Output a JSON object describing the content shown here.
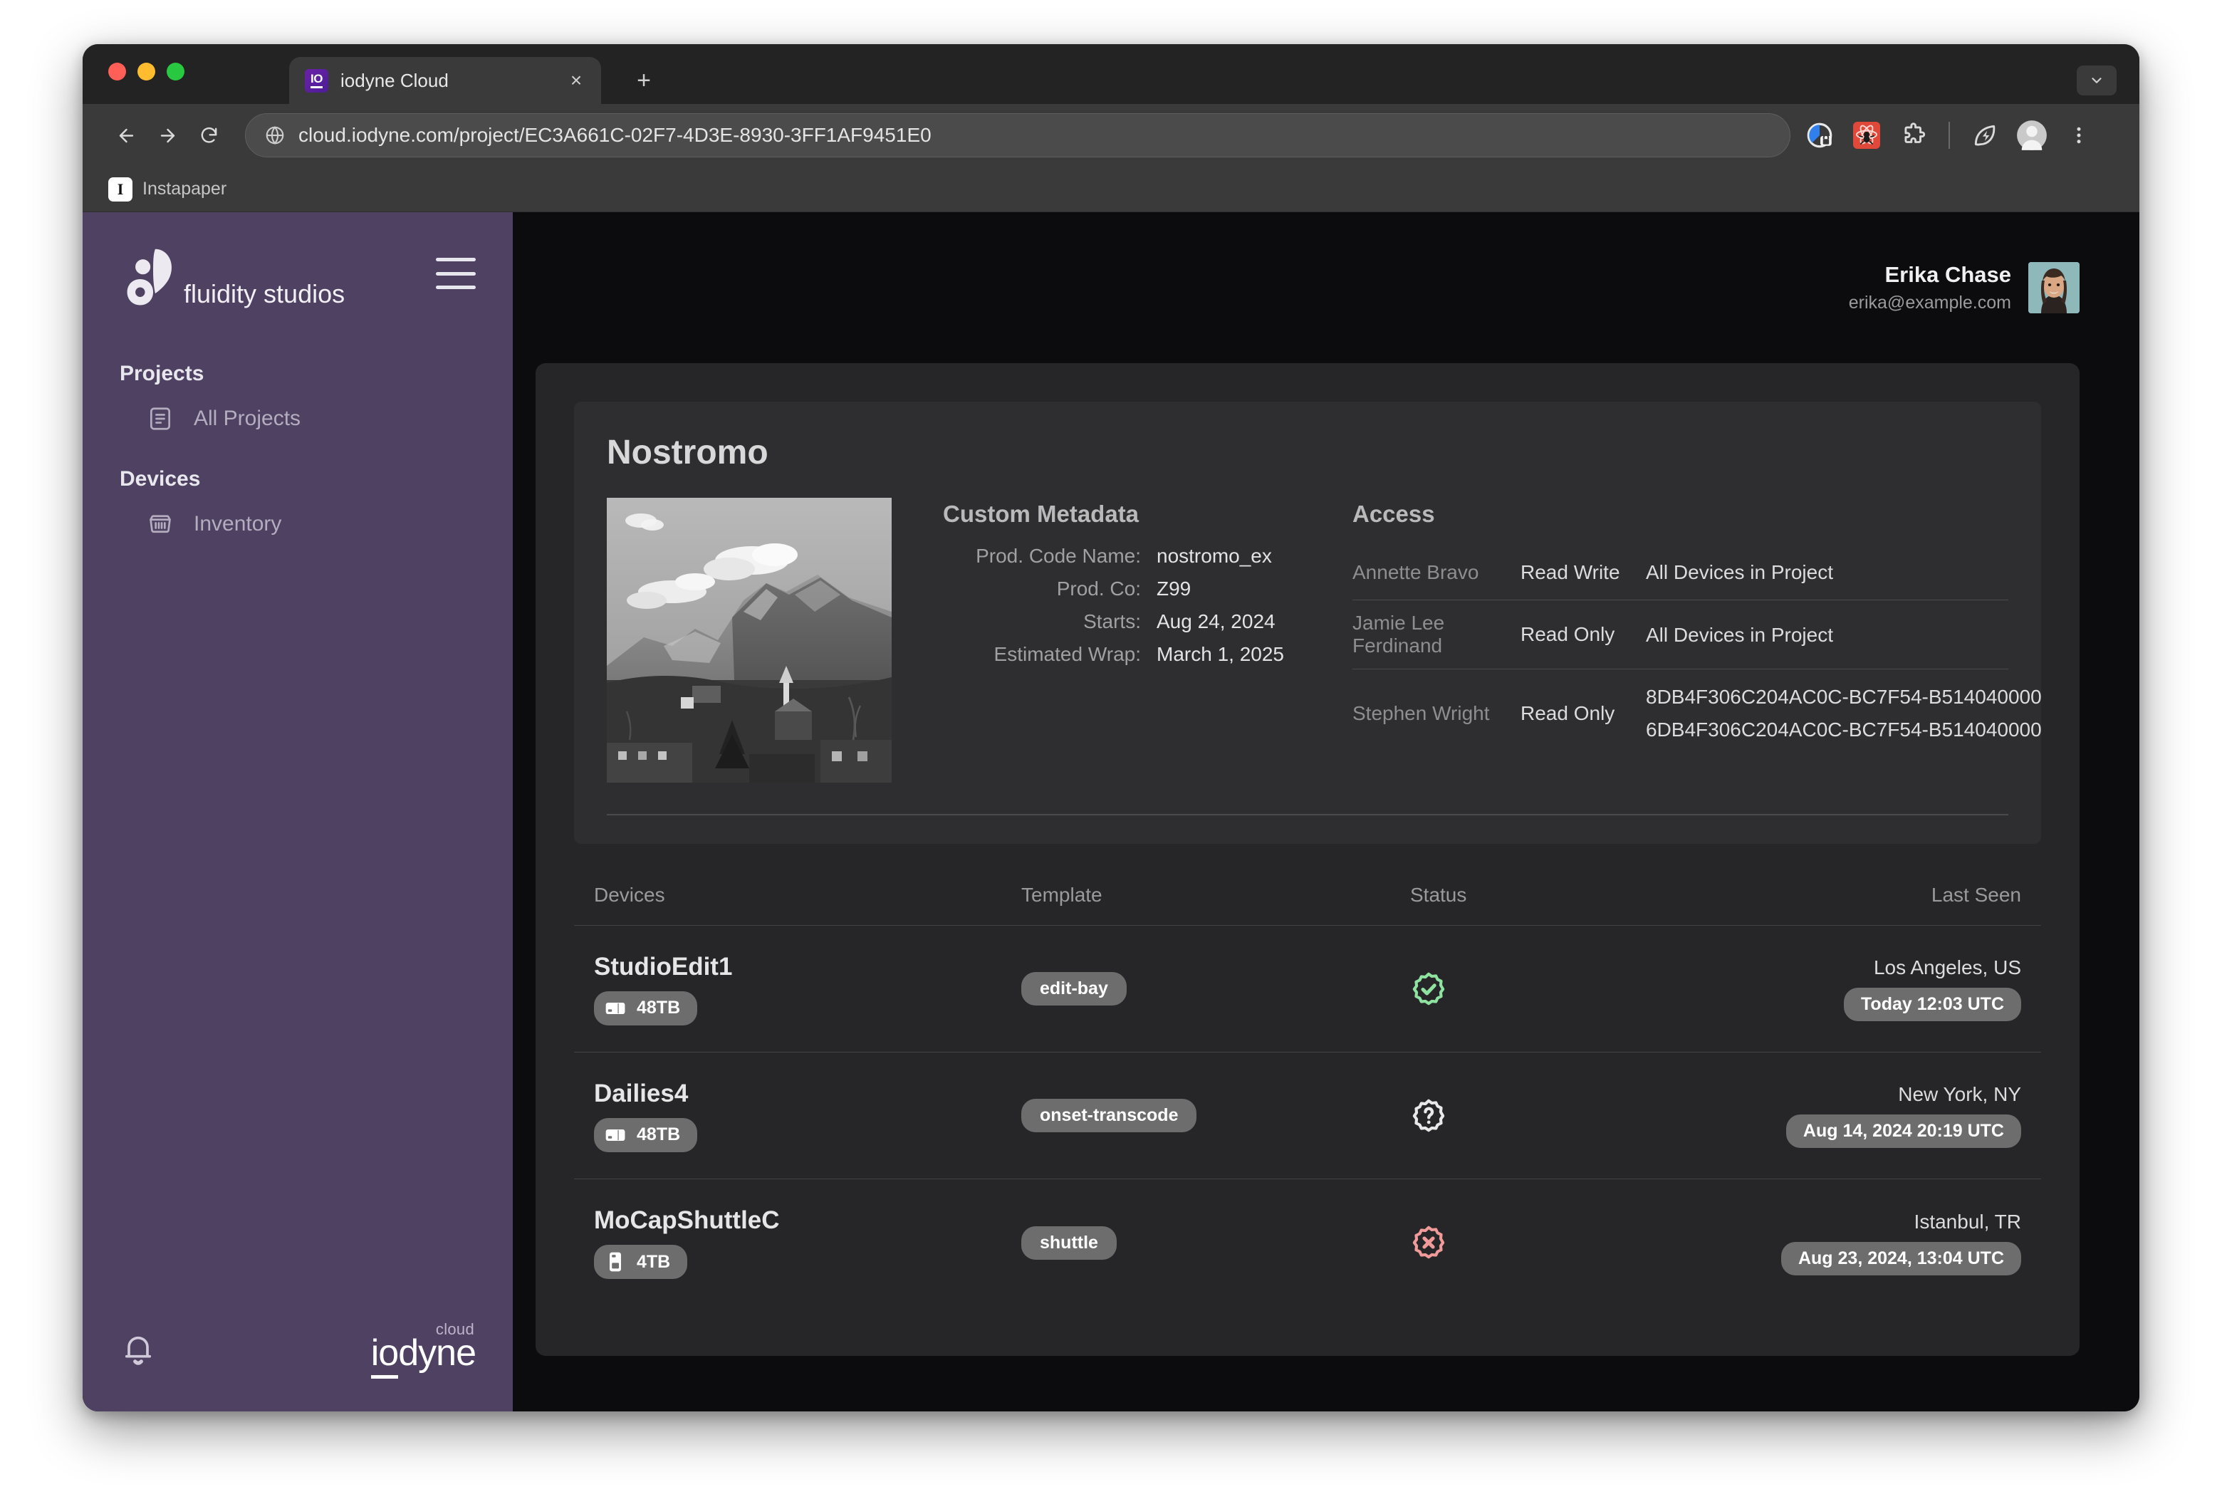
{
  "browser": {
    "tab": {
      "title": "iodyne Cloud",
      "favicon_label": "IO",
      "close_label": "×"
    },
    "new_tab_label": "+",
    "tab_list_label": "⌄",
    "url": "cloud.iodyne.com/project/EC3A661C-02F7-4D3E-8930-3FF1AF9451E0",
    "nav": {
      "back": "back-arrow-icon",
      "forward": "forward-arrow-icon",
      "reload": "reload-icon"
    },
    "omnibox_icon": "globe-icon",
    "actions": [
      {
        "name": "privacy-badge-icon"
      },
      {
        "name": "react-devtools-extension-icon"
      },
      {
        "name": "extensions-puzzle-icon"
      },
      {
        "name": "separator"
      },
      {
        "name": "leaf-performance-icon"
      },
      {
        "name": "profile-avatar-icon"
      },
      {
        "name": "chrome-menu-icon"
      }
    ],
    "bookmarks": [
      {
        "label": "Instapaper",
        "favicon_label": "I"
      }
    ]
  },
  "sidebar": {
    "brand_name": "fluidity studios",
    "menu_label": "hamburger-menu",
    "sections": [
      {
        "label": "Projects",
        "items": [
          {
            "label": "All Projects",
            "icon": "document-list-icon"
          }
        ]
      },
      {
        "label": "Devices",
        "items": [
          {
            "label": "Inventory",
            "icon": "drive-array-icon"
          }
        ]
      }
    ],
    "footer": {
      "bell": "notification-bell-icon",
      "logo_word": "iodyne",
      "logo_word_prefix": "io",
      "logo_word_suffix": "dyne",
      "logo_superscript": "cloud"
    }
  },
  "header": {
    "user_name": "Erika Chase",
    "user_email": "erika@example.com",
    "avatar": "user-avatar"
  },
  "project": {
    "title": "Nostromo",
    "thumbnail_alt": "mountain-town-photo",
    "metadata": {
      "heading": "Custom Metadata",
      "rows": [
        {
          "key": "Prod. Code Name:",
          "value": "nostromo_ex"
        },
        {
          "key": "Prod. Co:",
          "value": "Z99"
        },
        {
          "key": "Starts:",
          "value": "Aug 24, 2024"
        },
        {
          "key": "Estimated Wrap:",
          "value": "March 1, 2025"
        }
      ]
    },
    "access": {
      "heading": "Access",
      "rows": [
        {
          "name": "Annette Bravo",
          "permission": "Read Write",
          "devices": [
            "All Devices in Project"
          ]
        },
        {
          "name": "Jamie Lee Ferdinand",
          "permission": "Read Only",
          "devices": [
            "All Devices in Project"
          ]
        },
        {
          "name": "Stephen Wright",
          "permission": "Read Only",
          "devices": [
            "8DB4F306C204AC0C-BC7F54-B514040000",
            "6DB4F306C204AC0C-BC7F54-B514040000"
          ]
        }
      ]
    }
  },
  "devices_table": {
    "columns": [
      "Devices",
      "Template",
      "Status",
      "Last Seen"
    ],
    "rows": [
      {
        "name": "StudioEdit1",
        "capacity": "48TB",
        "capacity_icon": "drive-landscape-icon",
        "template": "edit-bay",
        "status": "online",
        "status_icon": "badge-check-icon",
        "status_color": "#8fe3a0",
        "location": "Los Angeles, US",
        "last_seen": "Today 12:03 UTC"
      },
      {
        "name": "Dailies4",
        "capacity": "48TB",
        "capacity_icon": "drive-landscape-icon",
        "template": "onset-transcode",
        "status": "unknown",
        "status_icon": "badge-question-icon",
        "status_color": "#e8e8e8",
        "location": "New York, NY",
        "last_seen": "Aug 14, 2024 20:19 UTC"
      },
      {
        "name": "MoCapShuttleC",
        "capacity": "4TB",
        "capacity_icon": "drive-portrait-icon",
        "template": "shuttle",
        "status": "offline",
        "status_icon": "badge-x-icon",
        "status_color": "#f09a9a",
        "location": "Istanbul, TR",
        "last_seen": "Aug 23, 2024, 13:04 UTC"
      }
    ]
  },
  "colors": {
    "sidebar_purple": "#4e4161",
    "page_background": "#0c0b0e",
    "card_background": "#262628",
    "panel_background": "#2e2e30",
    "badge_gray": "#6d6d6d",
    "status_ok": "#8fe3a0",
    "status_unknown": "#e8e8e8",
    "status_error": "#f09a9a"
  }
}
